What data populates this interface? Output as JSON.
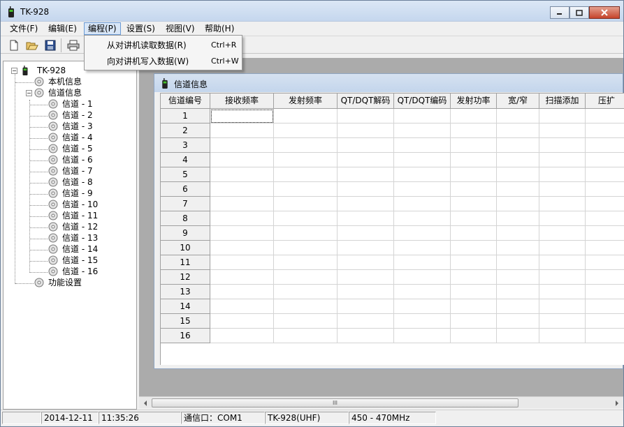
{
  "window": {
    "title": "TK-928"
  },
  "menu": {
    "items": [
      {
        "label": "文件(F)"
      },
      {
        "label": "编辑(E)"
      },
      {
        "label": "编程(P)"
      },
      {
        "label": "设置(S)"
      },
      {
        "label": "视图(V)"
      },
      {
        "label": "帮助(H)"
      }
    ],
    "dropdown": [
      {
        "label": "从对讲机读取数据(R)",
        "shortcut": "Ctrl+R"
      },
      {
        "label": "向对讲机写入数据(W)",
        "shortcut": "Ctrl+W"
      }
    ]
  },
  "tree": {
    "root": "TK-928",
    "local_info": "本机信息",
    "channel_info": "信道信息",
    "channels": [
      "信道 - 1",
      "信道 - 2",
      "信道 - 3",
      "信道 - 4",
      "信道 - 5",
      "信道 - 6",
      "信道 - 7",
      "信道 - 8",
      "信道 - 9",
      "信道 - 10",
      "信道 - 11",
      "信道 - 12",
      "信道 - 13",
      "信道 - 14",
      "信道 - 15",
      "信道 - 16"
    ],
    "function_settings": "功能设置"
  },
  "child_window": {
    "title": "信道信息"
  },
  "table": {
    "columns": [
      "信道编号",
      "接收频率",
      "发射频率",
      "QT/DQT解码",
      "QT/DQT编码",
      "发射功率",
      "宽/窄",
      "扫描添加",
      "压扩"
    ],
    "rows": [
      "1",
      "2",
      "3",
      "4",
      "5",
      "6",
      "7",
      "8",
      "9",
      "10",
      "11",
      "12",
      "13",
      "14",
      "15",
      "16"
    ]
  },
  "scrollbar": {
    "grip": "III"
  },
  "status": {
    "date": "2014-12-11",
    "time": "11:35:26",
    "port": "通信口：COM1",
    "model": "TK-928(UHF)",
    "band": "450 - 470MHz"
  },
  "colors": {
    "accent": "#3a8e22",
    "menu_highlight": "#d8e6f7"
  }
}
